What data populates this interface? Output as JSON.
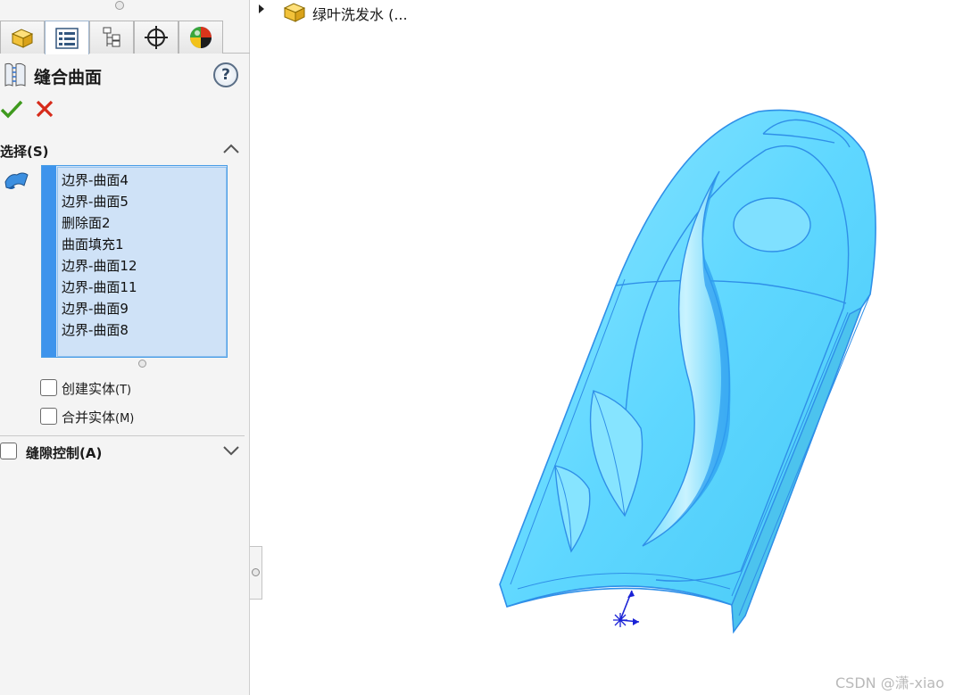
{
  "panel": {
    "tabs": [
      {
        "name": "featuremanager",
        "icon": "part-icon"
      },
      {
        "name": "propertymanager",
        "icon": "property-list-icon"
      },
      {
        "name": "configurationmanager",
        "icon": "configuration-icon"
      },
      {
        "name": "dimxpertmanager",
        "icon": "crosshair-icon"
      },
      {
        "name": "displaymanager",
        "icon": "appearance-ball-icon"
      }
    ],
    "title": "缝合曲面",
    "help_label": "?",
    "selection": {
      "label": "选择(S)",
      "items": [
        "边界-曲面4",
        "边界-曲面5",
        "删除面2",
        "曲面填充1",
        "边界-曲面12",
        "边界-曲面11",
        "边界-曲面9",
        "边界-曲面8"
      ]
    },
    "options": {
      "create_solid": {
        "label": "创建实体",
        "shortcut": "(T)",
        "checked": false
      },
      "merge_entities": {
        "label": "合并实体",
        "shortcut": "(M)",
        "checked": false
      }
    },
    "gap_control": {
      "label": "缝隙控制(A)",
      "checked": false
    }
  },
  "tree": {
    "part_name": "绿叶洗发水 (..."
  },
  "watermark": "CSDN @潇-xiao",
  "colors": {
    "accent": "#3e94ec",
    "model_fill": "#5fd7ff",
    "model_edge": "#2f8fe8",
    "ok": "#3f9a1e",
    "cancel": "#d62a1a"
  }
}
